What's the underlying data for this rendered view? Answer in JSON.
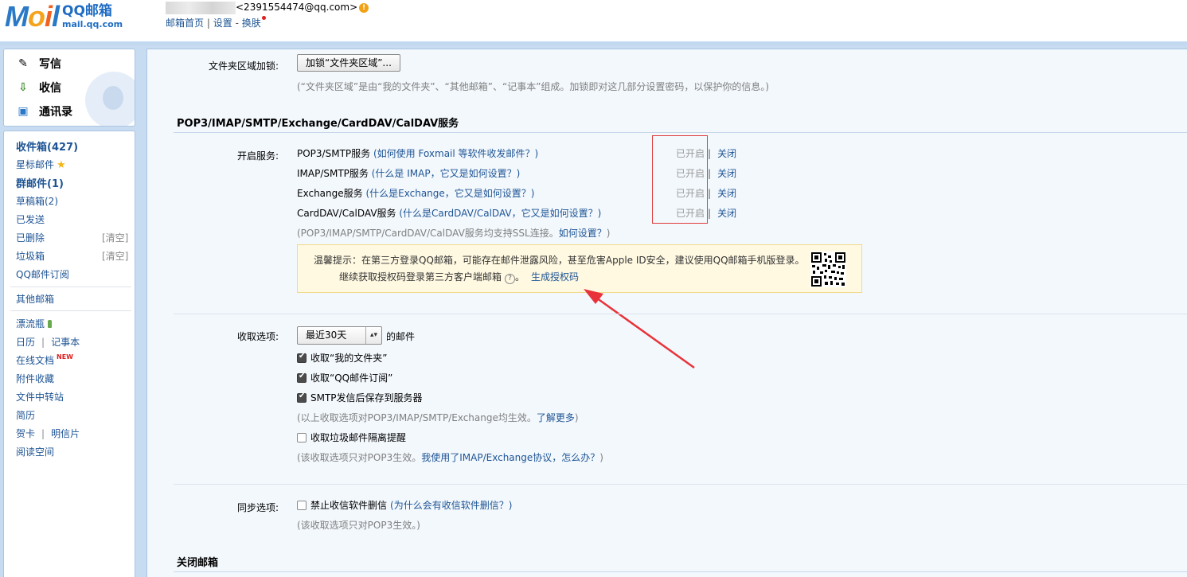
{
  "header": {
    "logo_text": "MOil",
    "brand_name": "QQ邮箱",
    "brand_domain": "mail.qq.com",
    "user_email": "<2391554474@qq.com>",
    "warn_icon": "!",
    "links": {
      "home": "邮箱首页",
      "sep": "|",
      "settings": "设置",
      "dash": "-",
      "skin": "换肤"
    }
  },
  "sidebar": {
    "compose": "写信",
    "inbox_btn": "收信",
    "contacts": "通讯录",
    "folders": {
      "inbox": "收件箱(427)",
      "starred": "星标邮件",
      "group": "群邮件(1)",
      "drafts": "草稿箱(2)",
      "sent": "已发送",
      "deleted": "已删除",
      "deleted_clear": "[清空]",
      "spam": "垃圾箱",
      "spam_clear": "[清空]",
      "subscriptions": "QQ邮件订阅",
      "other_mailbox": "其他邮箱",
      "drift_bottle": "漂流瓶",
      "calendar": "日历",
      "bar": "|",
      "notes": "记事本",
      "online_docs": "在线文档",
      "new_tag": "NEW",
      "attachments": "附件收藏",
      "file_transfer": "文件中转站",
      "resume": "简历",
      "card": "贺卡",
      "postcard": "明信片",
      "reading": "阅读空间"
    }
  },
  "main": {
    "folder_lock_label": "文件夹区域加锁:",
    "folder_lock_button": "加锁“文件夹区域”...",
    "folder_lock_hint": "(“文件夹区域”是由“我的文件夹”、“其他邮箱”、“记事本”组成。加锁即对这几部分设置密码，以保护你的信息。)",
    "section_services": "POP3/IMAP/SMTP/Exchange/CardDAV/CalDAV服务",
    "enable_label": "开启服务:",
    "services": [
      {
        "name": "POP3/SMTP服务",
        "help": "(如何使用 Foxmail 等软件收发邮件？)",
        "state": "已开启",
        "bar": "|",
        "action": "关闭"
      },
      {
        "name": "IMAP/SMTP服务",
        "help": "(什么是 IMAP，它又是如何设置？)",
        "state": "已开启",
        "bar": "|",
        "action": "关闭"
      },
      {
        "name": "Exchange服务",
        "help": "(什么是Exchange，它又是如何设置？)",
        "state": "已开启",
        "bar": "|",
        "action": "关闭"
      },
      {
        "name": "CardDAV/CalDAV服务",
        "help": "(什么是CardDAV/CalDAV，它又是如何设置？)",
        "state": "已开启",
        "bar": "|",
        "action": "关闭"
      }
    ],
    "ssl_hint": "(POP3/IMAP/SMTP/CardDAV/CalDAV服务均支持SSL连接。",
    "ssl_link": "如何设置？",
    "ssl_close": ")",
    "tip_line1": "温馨提示：在第三方登录QQ邮箱，可能存在邮件泄露风险，甚至危害Apple ID安全，建议使用QQ邮箱手机版登录。",
    "tip_line2": "继续获取授权码登录第三方客户端邮箱",
    "tip_qmark": "?",
    "tip_link": "生成授权码",
    "receive_label": "收取选项:",
    "receive_select": "最近30天",
    "receive_suffix": "的邮件",
    "receive_opts": [
      {
        "label": "收取“我的文件夹”",
        "checked": true
      },
      {
        "label": "收取“QQ邮件订阅”",
        "checked": true
      },
      {
        "label": "SMTP发信后保存到服务器",
        "checked": true
      }
    ],
    "receive_hint": "(以上收取选项对POP3/IMAP/SMTP/Exchange均生效。",
    "receive_hint_link": "了解更多",
    "receive_hint_close": ")",
    "spam_opt": "收取垃圾邮件隔离提醒",
    "spam_hint": "(该收取选项只对POP3生效。",
    "spam_hint_link": "我使用了IMAP/Exchange协议，怎么办？",
    "spam_hint_close": ")",
    "sync_label": "同步选项:",
    "sync_opt": "禁止收信软件删信",
    "sync_opt_link": "(为什么会有收信软件删信？)",
    "sync_hint": "(该收取选项只对POP3生效。)",
    "section_close": "关闭邮箱"
  },
  "colors": {
    "accent_blue": "#1e5494",
    "sidebar_bg": "#c7dcf1",
    "tip_bg": "#fff9e2",
    "annotation_red": "#e03a3a"
  }
}
